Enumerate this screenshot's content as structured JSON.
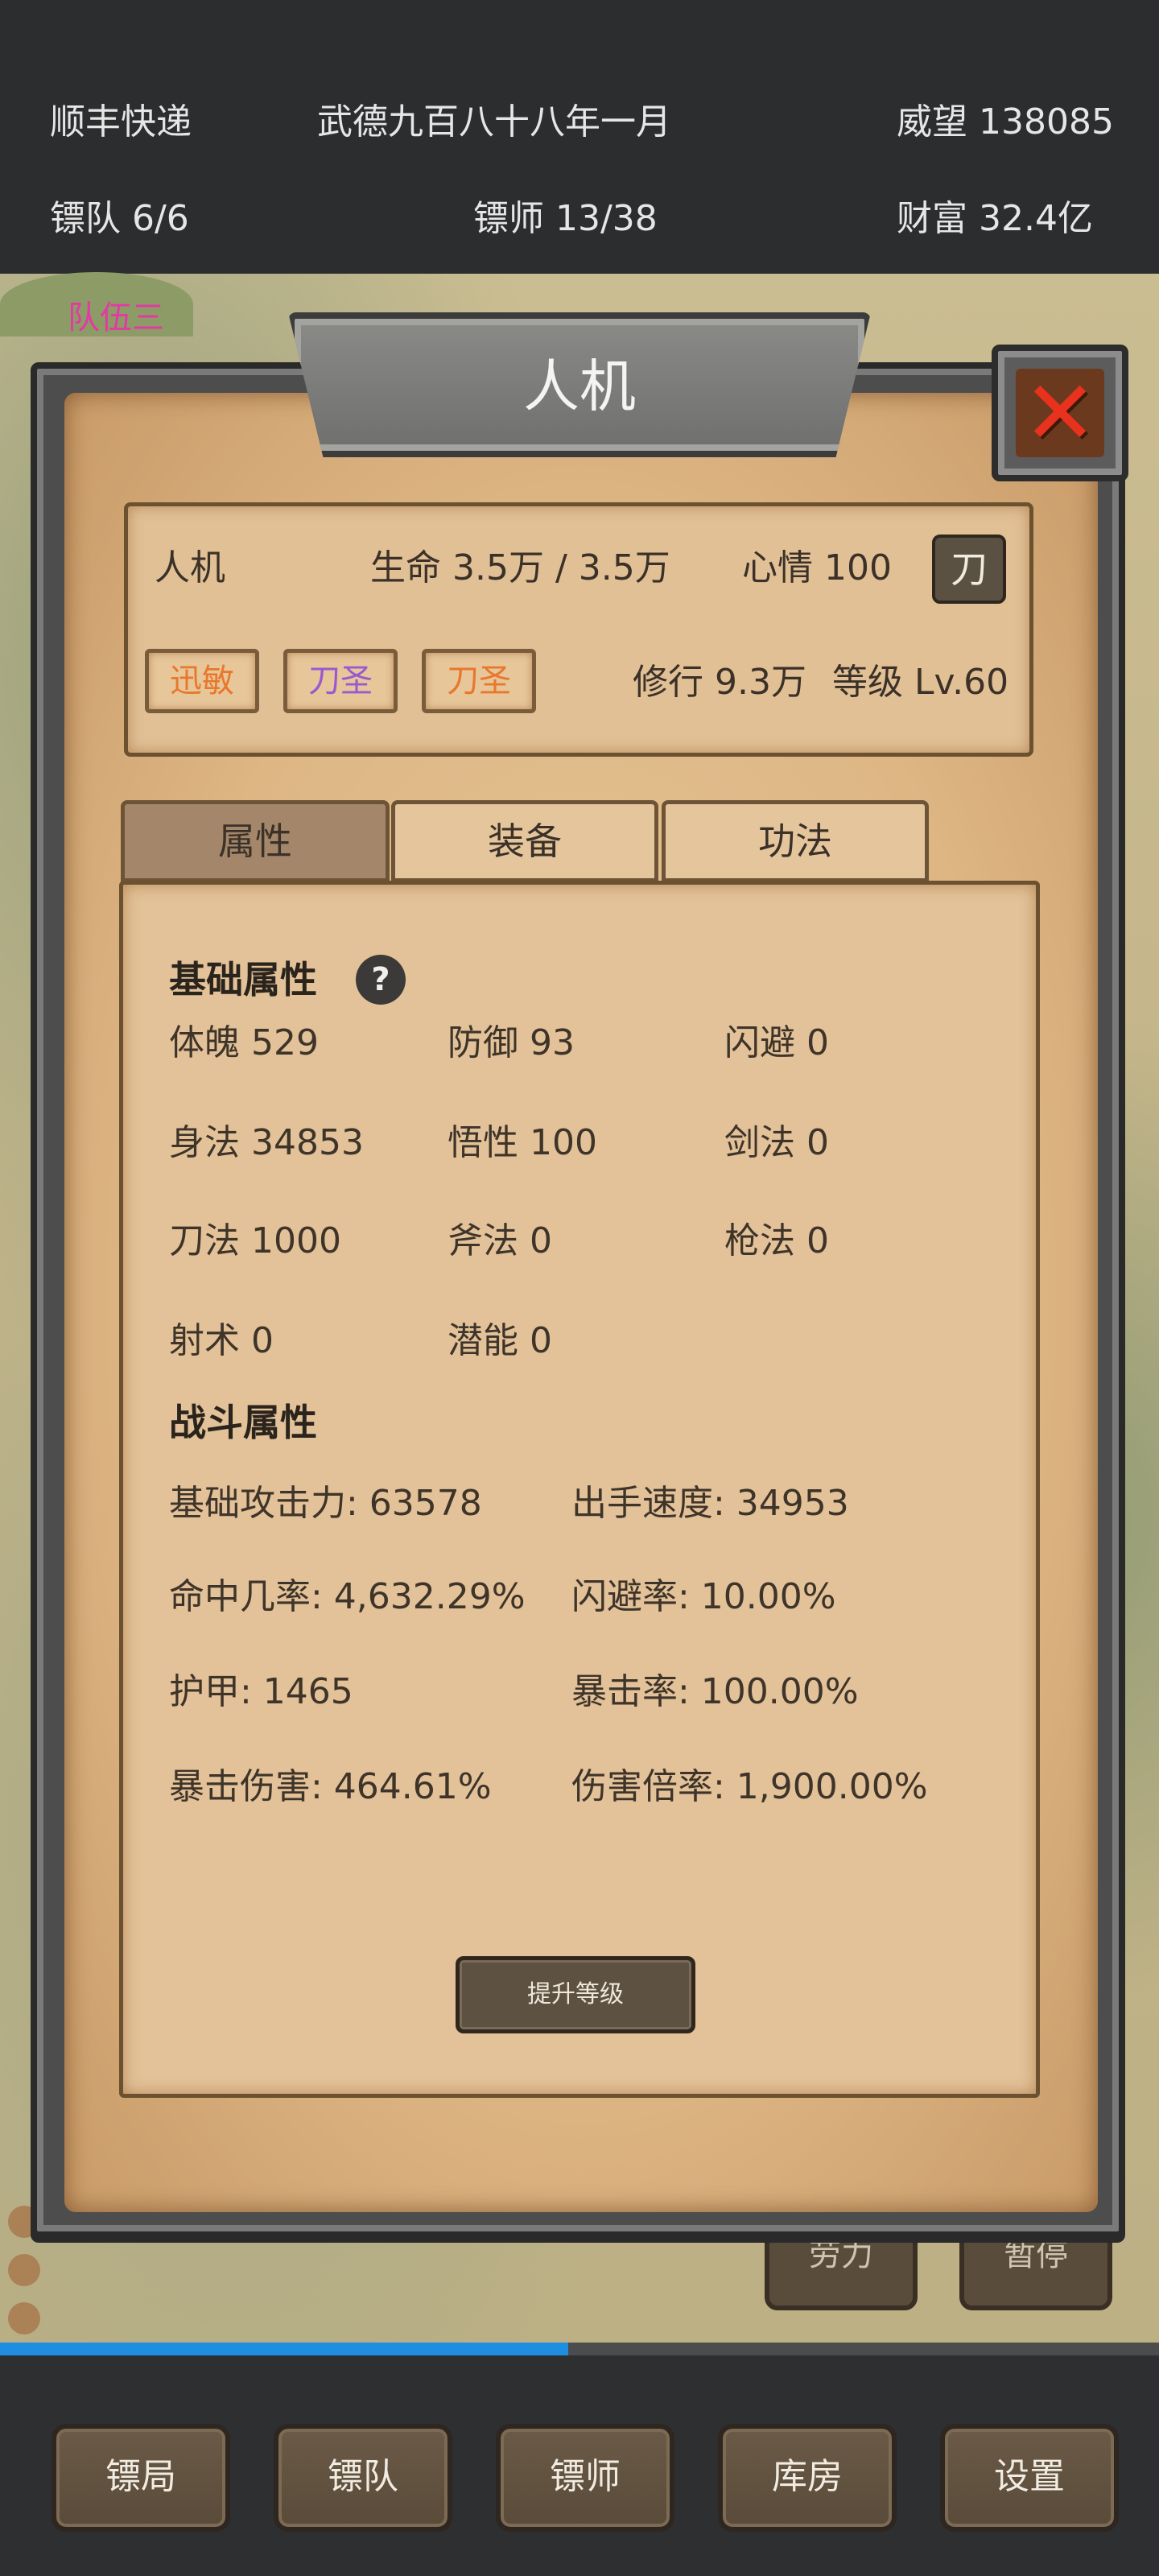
{
  "topbar": {
    "company": "顺丰快递",
    "date": "武德九百八十八年一月",
    "prestige": "威望 138085",
    "teams": "镖队 6/6",
    "escorts": "镖师 13/38",
    "wealth": "财富  32.4亿"
  },
  "map": {
    "troop_label": "队伍三",
    "ghost_buttons": [
      "劳力",
      "暂停"
    ]
  },
  "dialog": {
    "title": "人机",
    "close_icon": "close-x-icon",
    "card": {
      "name": "人机",
      "hp": "生命 3.5万 / 3.5万",
      "mood": "心情 100",
      "weapon": "刀",
      "practice": "修行 9.3万",
      "level": "等级 Lv.60",
      "tags": [
        {
          "label": "迅敏",
          "color": "#e8782c"
        },
        {
          "label": "刀圣",
          "color": "#9b59d0"
        },
        {
          "label": "刀圣",
          "color": "#e8782c"
        }
      ]
    },
    "tabs": [
      "属性",
      "装备",
      "功法"
    ],
    "active_tab": "属性",
    "basic": {
      "title": "基础属性",
      "help_icon": "question-icon",
      "stats": [
        "体魄 529",
        "防御 93",
        "闪避 0",
        "身法 34853",
        "悟性 100",
        "剑法 0",
        "刀法 1000",
        "斧法 0",
        "枪法 0",
        "射术 0",
        "潜能 0"
      ]
    },
    "combat": {
      "title": "战斗属性",
      "stats": [
        "基础攻击力: 63578",
        "出手速度: 34953",
        "命中几率: 4,632.29%",
        "闪避率: 10.00%",
        "护甲:  1465",
        "暴击率: 100.00%",
        "暴击伤害: 464.61%",
        "伤害倍率: 1,900.00%"
      ]
    },
    "levelup_button": "提升等级"
  },
  "progress": {
    "value": 0.49,
    "color": "#1f8de0"
  },
  "bottom_nav": [
    "镖局",
    "镖队",
    "镖师",
    "库房",
    "设置"
  ]
}
